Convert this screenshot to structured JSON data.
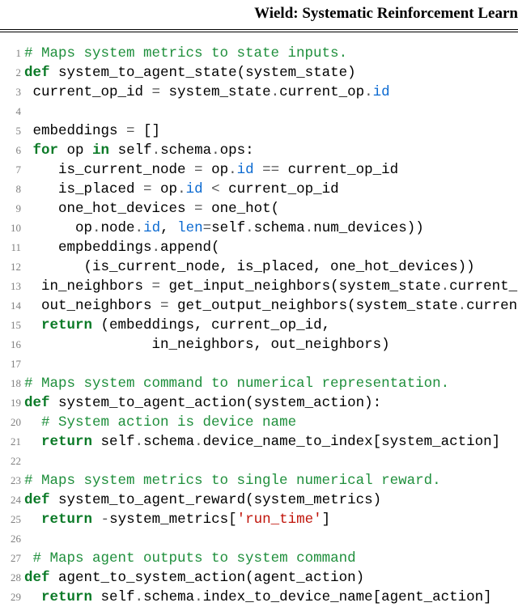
{
  "header": "Wield: Systematic Reinforcement Learn",
  "code": {
    "lines": [
      {
        "n": 1,
        "t": [
          {
            "c": "tok-cmt",
            "s": "# Maps system metrics to state inputs."
          }
        ]
      },
      {
        "n": 2,
        "t": [
          {
            "c": "tok-def",
            "s": "def"
          },
          {
            "c": "tok-p",
            "s": " "
          },
          {
            "c": "tok-nm",
            "s": "system_to_agent_state"
          },
          {
            "c": "tok-p",
            "s": "(system_state)"
          }
        ]
      },
      {
        "n": 3,
        "t": [
          {
            "c": "tok-p",
            "s": " current_op_id "
          },
          {
            "c": "tok-op",
            "s": "="
          },
          {
            "c": "tok-p",
            "s": " system_state"
          },
          {
            "c": "tok-op",
            "s": "."
          },
          {
            "c": "tok-nm",
            "s": "current_op"
          },
          {
            "c": "tok-op",
            "s": "."
          },
          {
            "c": "tok-attr",
            "s": "id"
          }
        ]
      },
      {
        "n": 4,
        "t": [
          {
            "c": "tok-p",
            "s": " "
          }
        ]
      },
      {
        "n": 5,
        "t": [
          {
            "c": "tok-p",
            "s": " embeddings "
          },
          {
            "c": "tok-op",
            "s": "="
          },
          {
            "c": "tok-p",
            "s": " []"
          }
        ]
      },
      {
        "n": 6,
        "t": [
          {
            "c": "tok-p",
            "s": " "
          },
          {
            "c": "tok-kw",
            "s": "for"
          },
          {
            "c": "tok-p",
            "s": " op "
          },
          {
            "c": "tok-kw",
            "s": "in"
          },
          {
            "c": "tok-p",
            "s": " self"
          },
          {
            "c": "tok-op",
            "s": "."
          },
          {
            "c": "tok-nm",
            "s": "schema"
          },
          {
            "c": "tok-op",
            "s": "."
          },
          {
            "c": "tok-nm",
            "s": "ops:"
          }
        ]
      },
      {
        "n": 7,
        "t": [
          {
            "c": "tok-p",
            "s": "    is_current_node "
          },
          {
            "c": "tok-op",
            "s": "="
          },
          {
            "c": "tok-p",
            "s": " op"
          },
          {
            "c": "tok-op",
            "s": "."
          },
          {
            "c": "tok-attr",
            "s": "id"
          },
          {
            "c": "tok-p",
            "s": " "
          },
          {
            "c": "tok-op",
            "s": "=="
          },
          {
            "c": "tok-p",
            "s": " current_op_id"
          }
        ]
      },
      {
        "n": 8,
        "t": [
          {
            "c": "tok-p",
            "s": "    is_placed "
          },
          {
            "c": "tok-op",
            "s": "="
          },
          {
            "c": "tok-p",
            "s": " op"
          },
          {
            "c": "tok-op",
            "s": "."
          },
          {
            "c": "tok-attr",
            "s": "id"
          },
          {
            "c": "tok-p",
            "s": " "
          },
          {
            "c": "tok-op",
            "s": "<"
          },
          {
            "c": "tok-p",
            "s": " current_op_id"
          }
        ]
      },
      {
        "n": 9,
        "t": [
          {
            "c": "tok-p",
            "s": "    one_hot_devices "
          },
          {
            "c": "tok-op",
            "s": "="
          },
          {
            "c": "tok-p",
            "s": " one_hot("
          }
        ]
      },
      {
        "n": 10,
        "t": [
          {
            "c": "tok-p",
            "s": "      op"
          },
          {
            "c": "tok-op",
            "s": "."
          },
          {
            "c": "tok-nm",
            "s": "node"
          },
          {
            "c": "tok-op",
            "s": "."
          },
          {
            "c": "tok-attr",
            "s": "id"
          },
          {
            "c": "tok-p",
            "s": ", "
          },
          {
            "c": "tok-attr",
            "s": "len"
          },
          {
            "c": "tok-op",
            "s": "="
          },
          {
            "c": "tok-nm",
            "s": "self"
          },
          {
            "c": "tok-op",
            "s": "."
          },
          {
            "c": "tok-nm",
            "s": "schema"
          },
          {
            "c": "tok-op",
            "s": "."
          },
          {
            "c": "tok-nm",
            "s": "num_devices))"
          }
        ]
      },
      {
        "n": 11,
        "t": [
          {
            "c": "tok-p",
            "s": "    empbeddings"
          },
          {
            "c": "tok-op",
            "s": "."
          },
          {
            "c": "tok-nm",
            "s": "append("
          }
        ]
      },
      {
        "n": 12,
        "t": [
          {
            "c": "tok-p",
            "s": "       (is_current_node, is_placed, one_hot_devices))"
          }
        ]
      },
      {
        "n": 13,
        "t": [
          {
            "c": "tok-p",
            "s": "  in_neighbors "
          },
          {
            "c": "tok-op",
            "s": "="
          },
          {
            "c": "tok-p",
            "s": " get_input_neighbors(system_state"
          },
          {
            "c": "tok-op",
            "s": "."
          },
          {
            "c": "tok-nm",
            "s": "current_op)"
          }
        ]
      },
      {
        "n": 14,
        "t": [
          {
            "c": "tok-p",
            "s": "  out_neighbors "
          },
          {
            "c": "tok-op",
            "s": "="
          },
          {
            "c": "tok-p",
            "s": " get_output_neighbors(system_state"
          },
          {
            "c": "tok-op",
            "s": "."
          },
          {
            "c": "tok-nm",
            "s": "current_op)"
          }
        ]
      },
      {
        "n": 15,
        "t": [
          {
            "c": "tok-p",
            "s": "  "
          },
          {
            "c": "tok-kw",
            "s": "return"
          },
          {
            "c": "tok-p",
            "s": " (embeddings, current_op_id,"
          }
        ]
      },
      {
        "n": 16,
        "t": [
          {
            "c": "tok-p",
            "s": "               in_neighbors, out_neighbors)"
          }
        ]
      },
      {
        "n": 17,
        "t": [
          {
            "c": "tok-p",
            "s": " "
          }
        ]
      },
      {
        "n": 18,
        "t": [
          {
            "c": "tok-cmt",
            "s": "# Maps system command to numerical representation."
          }
        ]
      },
      {
        "n": 19,
        "t": [
          {
            "c": "tok-def",
            "s": "def"
          },
          {
            "c": "tok-p",
            "s": " "
          },
          {
            "c": "tok-nm",
            "s": "system_to_agent_action"
          },
          {
            "c": "tok-p",
            "s": "(system_action):"
          }
        ]
      },
      {
        "n": 20,
        "t": [
          {
            "c": "tok-p",
            "s": "  "
          },
          {
            "c": "tok-cmt",
            "s": "# System action is device name"
          }
        ]
      },
      {
        "n": 21,
        "t": [
          {
            "c": "tok-p",
            "s": "  "
          },
          {
            "c": "tok-kw",
            "s": "return"
          },
          {
            "c": "tok-p",
            "s": " self"
          },
          {
            "c": "tok-op",
            "s": "."
          },
          {
            "c": "tok-nm",
            "s": "schema"
          },
          {
            "c": "tok-op",
            "s": "."
          },
          {
            "c": "tok-nm",
            "s": "device_name_to_index[system_action]"
          }
        ]
      },
      {
        "n": 22,
        "t": [
          {
            "c": "tok-p",
            "s": " "
          }
        ]
      },
      {
        "n": 23,
        "t": [
          {
            "c": "tok-cmt",
            "s": "# Maps system metrics to single numerical reward."
          }
        ]
      },
      {
        "n": 24,
        "t": [
          {
            "c": "tok-def",
            "s": "def"
          },
          {
            "c": "tok-p",
            "s": " "
          },
          {
            "c": "tok-nm",
            "s": "system_to_agent_reward"
          },
          {
            "c": "tok-p",
            "s": "(system_metrics)"
          }
        ]
      },
      {
        "n": 25,
        "t": [
          {
            "c": "tok-p",
            "s": "  "
          },
          {
            "c": "tok-kw",
            "s": "return"
          },
          {
            "c": "tok-p",
            "s": " "
          },
          {
            "c": "tok-op",
            "s": "-"
          },
          {
            "c": "tok-nm",
            "s": "system_metrics["
          },
          {
            "c": "tok-str",
            "s": "'run_time'"
          },
          {
            "c": "tok-nm",
            "s": "]"
          }
        ]
      },
      {
        "n": 26,
        "t": [
          {
            "c": "tok-p",
            "s": " "
          }
        ]
      },
      {
        "n": 27,
        "t": [
          {
            "c": "tok-p",
            "s": " "
          },
          {
            "c": "tok-cmt",
            "s": "# Maps agent outputs to system command"
          }
        ]
      },
      {
        "n": 28,
        "t": [
          {
            "c": "tok-def",
            "s": "def"
          },
          {
            "c": "tok-p",
            "s": " "
          },
          {
            "c": "tok-nm",
            "s": "agent_to_system_action"
          },
          {
            "c": "tok-p",
            "s": "(agent_action)"
          }
        ]
      },
      {
        "n": 29,
        "t": [
          {
            "c": "tok-p",
            "s": "  "
          },
          {
            "c": "tok-kw",
            "s": "return"
          },
          {
            "c": "tok-p",
            "s": " self"
          },
          {
            "c": "tok-op",
            "s": "."
          },
          {
            "c": "tok-nm",
            "s": "schema"
          },
          {
            "c": "tok-op",
            "s": "."
          },
          {
            "c": "tok-nm",
            "s": "index_to_device_name[agent_action]"
          }
        ]
      }
    ]
  }
}
